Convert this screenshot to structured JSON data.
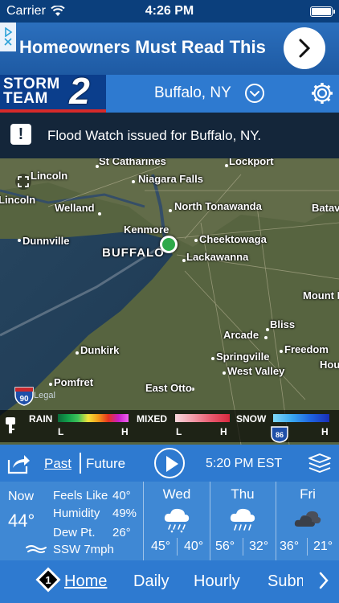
{
  "status_bar": {
    "carrier": "Carrier",
    "time": "4:26 PM"
  },
  "ad": {
    "headline": "Homeowners Must Read This"
  },
  "header": {
    "logo_text_line1": "STORM",
    "logo_text_line2": "TEAM",
    "logo_number": "2",
    "location": "Buffalo, NY"
  },
  "alert": {
    "icon": "!",
    "text": "Flood Watch issued for Buffalo, NY."
  },
  "map": {
    "places": [
      {
        "name": "St Catharines"
      },
      {
        "name": "Lockport"
      },
      {
        "name": "Lincoln"
      },
      {
        "name": "Niagara Falls"
      },
      {
        "name": "Lincoln"
      },
      {
        "name": "Welland"
      },
      {
        "name": "North Tonawanda"
      },
      {
        "name": "Batavia"
      },
      {
        "name": "Kenmore"
      },
      {
        "name": "Dunnville"
      },
      {
        "name": "BUFFALO"
      },
      {
        "name": "Cheektowaga"
      },
      {
        "name": "Lackawanna"
      },
      {
        "name": "Mount Morris"
      },
      {
        "name": "Bliss"
      },
      {
        "name": "Arcade"
      },
      {
        "name": "Dunkirk"
      },
      {
        "name": "Freedom"
      },
      {
        "name": "Springville"
      },
      {
        "name": "Houghton"
      },
      {
        "name": "West Valley"
      },
      {
        "name": "Pomfret"
      },
      {
        "name": "East Otto"
      }
    ],
    "legal": "Legal",
    "highway": "90",
    "highway2": "86",
    "legend": {
      "rain": "RAIN",
      "mixed": "MIXED",
      "snow": "SNOW",
      "low": "L",
      "high": "H",
      "rain_colors": [
        "#0b6b3a",
        "#12a04b",
        "#3fc35a",
        "#f2e23a",
        "#f29a1a",
        "#e8321e",
        "#c81ec8",
        "#f060f0"
      ],
      "mixed_colors": [
        "#f8d6dc",
        "#f29aa8",
        "#e8596e",
        "#d8283e"
      ],
      "snow_colors": [
        "#7fd8f8",
        "#3aa8f0",
        "#1e64e0",
        "#1a2fb8"
      ]
    }
  },
  "controls": {
    "past": "Past",
    "future": "Future",
    "time": "5:20 PM EST"
  },
  "current": {
    "label": "Now",
    "temp": "44°",
    "feels_like_label": "Feels Like",
    "feels_like": "40°",
    "humidity_label": "Humidity",
    "humidity": "49%",
    "dew_point_label": "Dew Pt.",
    "dew_point": "26°",
    "wind": "SSW 7mph"
  },
  "forecast": [
    {
      "day": "Wed",
      "icon": "rain-snow-icon",
      "hi": "45°",
      "lo": "40°"
    },
    {
      "day": "Thu",
      "icon": "rain-icon",
      "hi": "56°",
      "lo": "32°"
    },
    {
      "day": "Fri",
      "icon": "partly-cloudy-icon",
      "hi": "36°",
      "lo": "21°"
    }
  ],
  "tabs": {
    "badge": "1",
    "items": [
      "Home",
      "Daily",
      "Hourly",
      "Subm"
    ]
  }
}
